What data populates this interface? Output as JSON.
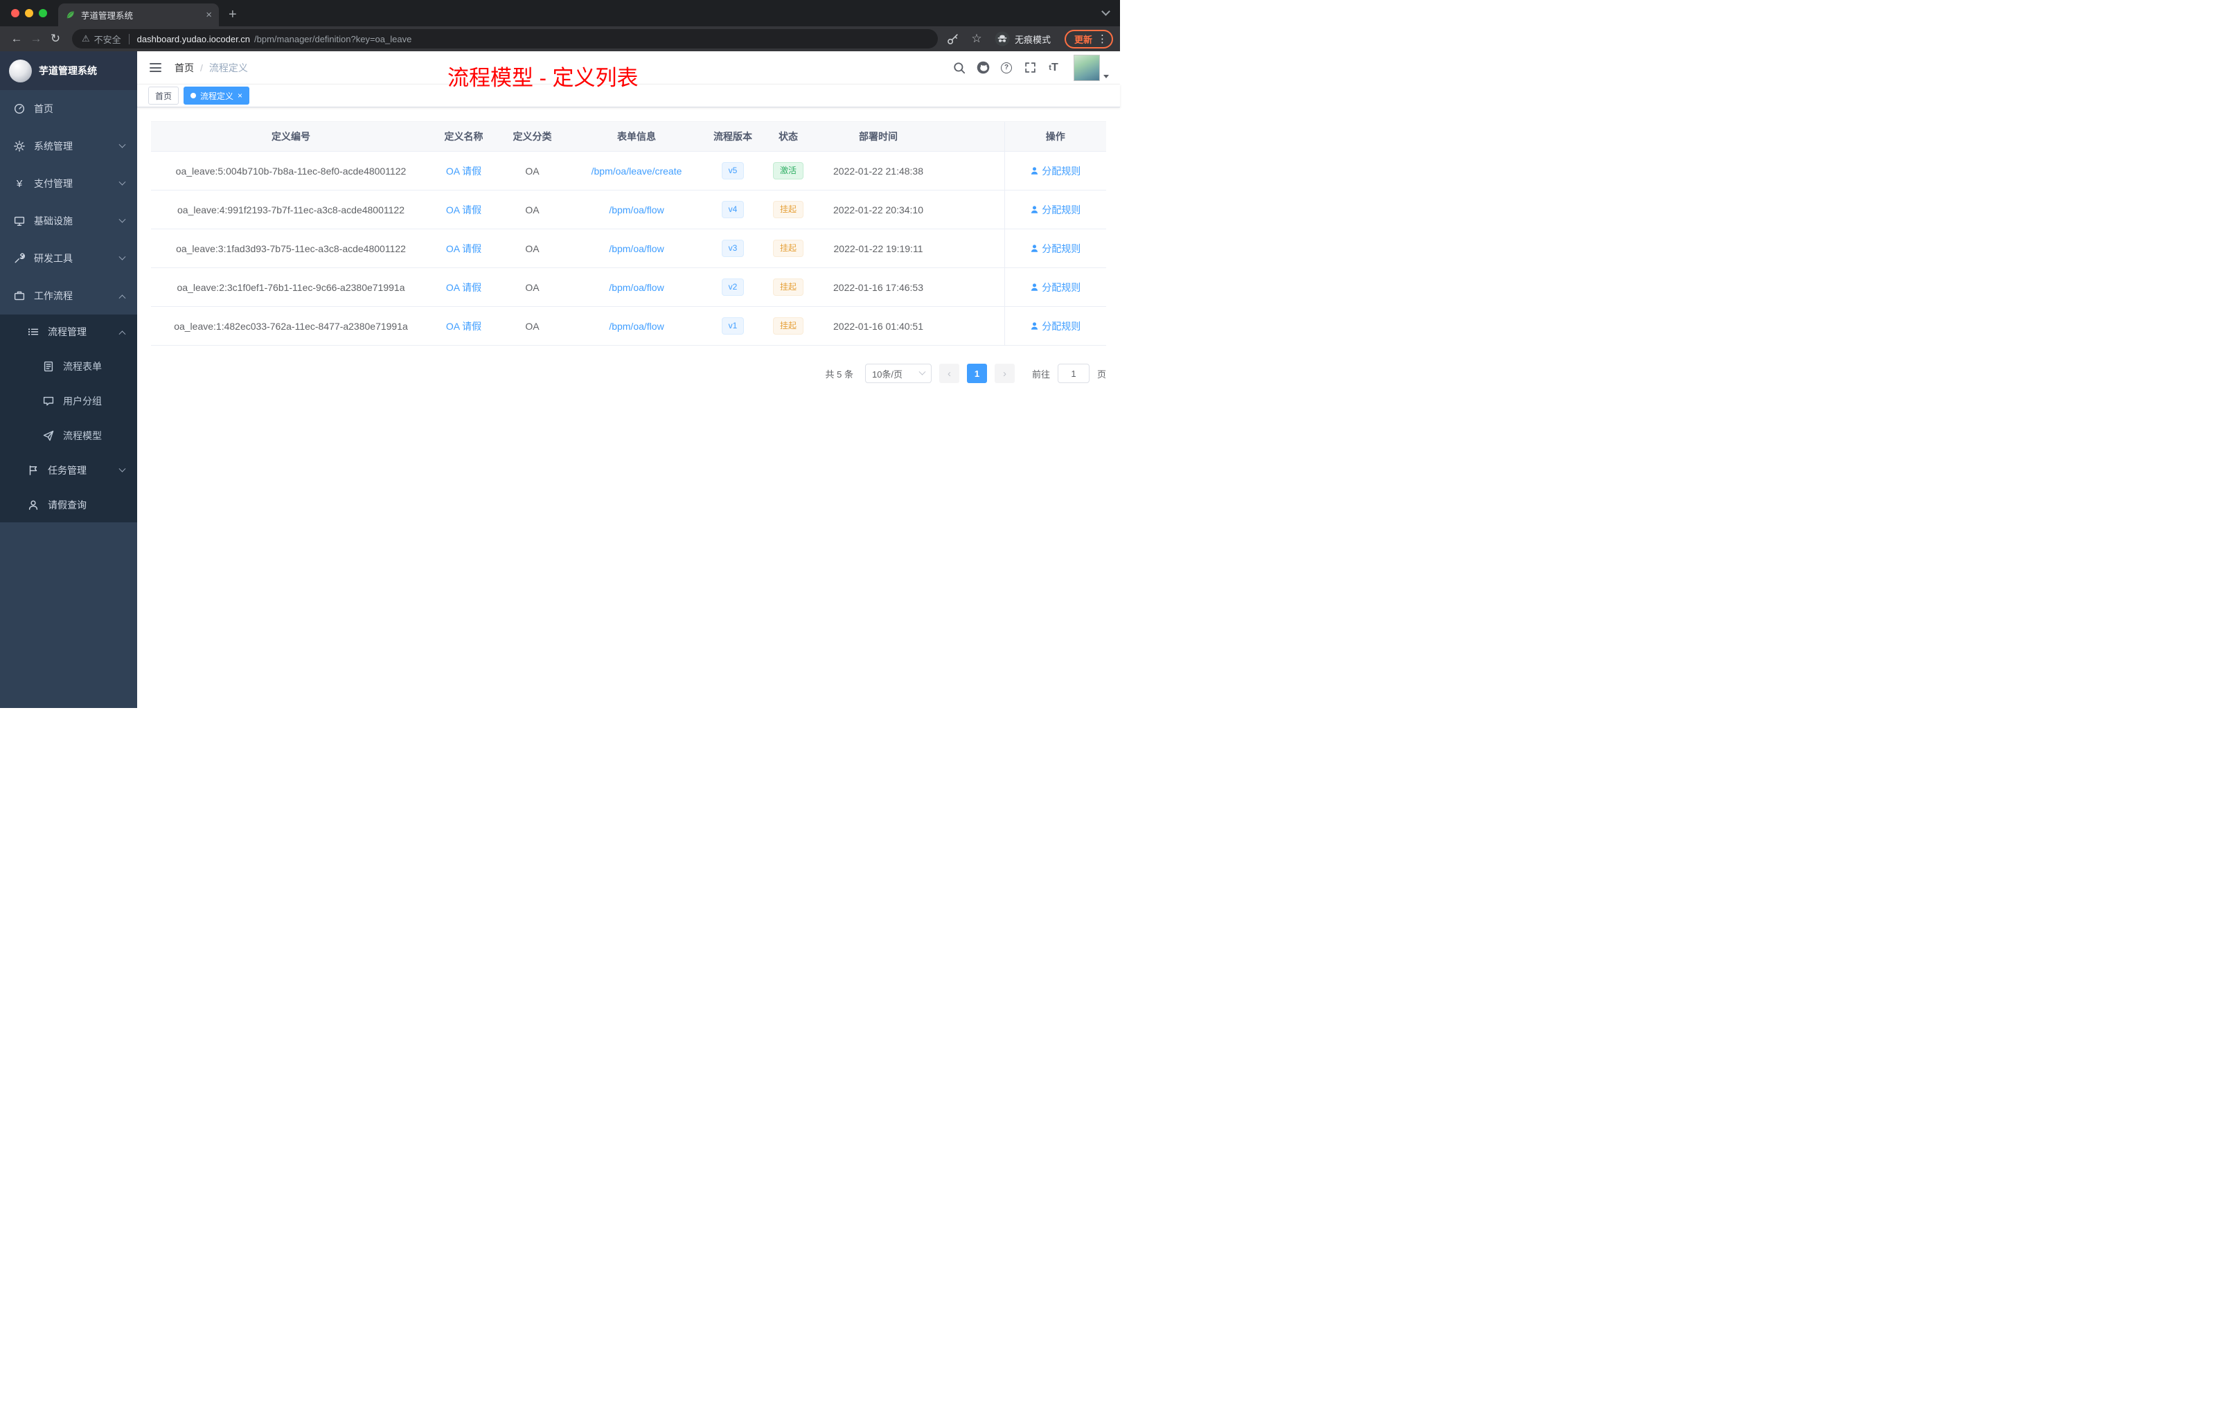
{
  "browser": {
    "tab_title": "芋道管理系统",
    "security_label": "不安全",
    "url_host": "dashboard.yudao.iocoder.cn",
    "url_path": "/bpm/manager/definition?key=oa_leave",
    "incognito_label": "无痕模式",
    "update_label": "更新"
  },
  "sidebar": {
    "logo_title": "芋道管理系统",
    "items": [
      {
        "label": "首页"
      },
      {
        "label": "系统管理"
      },
      {
        "label": "支付管理"
      },
      {
        "label": "基础设施"
      },
      {
        "label": "研发工具"
      },
      {
        "label": "工作流程"
      },
      {
        "label": "流程管理"
      },
      {
        "label": "流程表单"
      },
      {
        "label": "用户分组"
      },
      {
        "label": "流程模型"
      },
      {
        "label": "任务管理"
      },
      {
        "label": "请假查询"
      }
    ]
  },
  "topbar": {
    "breadcrumb_home": "首页",
    "breadcrumb_sep": "/",
    "breadcrumb_current": "流程定义",
    "annotation": "流程模型 - 定义列表"
  },
  "tags": {
    "home": "首页",
    "active": "流程定义"
  },
  "table": {
    "headers": [
      "定义编号",
      "定义名称",
      "定义分类",
      "表单信息",
      "流程版本",
      "状态",
      "部署时间",
      "操作"
    ],
    "rows": [
      {
        "id": "oa_leave:5:004b710b-7b8a-11ec-8ef0-acde48001122",
        "name": "OA 请假",
        "category": "OA",
        "form": "/bpm/oa/leave/create",
        "version": "v5",
        "status": "激活",
        "time": "2022-01-22 21:48:38",
        "action": "分配规则"
      },
      {
        "id": "oa_leave:4:991f2193-7b7f-11ec-a3c8-acde48001122",
        "name": "OA 请假",
        "category": "OA",
        "form": "/bpm/oa/flow",
        "version": "v4",
        "status": "挂起",
        "time": "2022-01-22 20:34:10",
        "action": "分配规则"
      },
      {
        "id": "oa_leave:3:1fad3d93-7b75-11ec-a3c8-acde48001122",
        "name": "OA 请假",
        "category": "OA",
        "form": "/bpm/oa/flow",
        "version": "v3",
        "status": "挂起",
        "time": "2022-01-22 19:19:11",
        "action": "分配规则"
      },
      {
        "id": "oa_leave:2:3c1f0ef1-76b1-11ec-9c66-a2380e71991a",
        "name": "OA 请假",
        "category": "OA",
        "form": "/bpm/oa/flow",
        "version": "v2",
        "status": "挂起",
        "time": "2022-01-16 17:46:53",
        "action": "分配规则"
      },
      {
        "id": "oa_leave:1:482ec033-762a-11ec-8477-a2380e71991a",
        "name": "OA 请假",
        "category": "OA",
        "form": "/bpm/oa/flow",
        "version": "v1",
        "status": "挂起",
        "time": "2022-01-16 01:40:51",
        "action": "分配规则"
      }
    ]
  },
  "pagination": {
    "total": "共 5 条",
    "page_size": "10条/页",
    "page": "1",
    "goto_label": "前往",
    "goto_value": "1",
    "unit": "页"
  },
  "colors": {
    "accent": "#409eff",
    "success": "#2fae64",
    "warning": "#e6a23c",
    "annotation": "#ff0000",
    "sidebar": "#304156",
    "submenu": "#1f2d3d"
  }
}
